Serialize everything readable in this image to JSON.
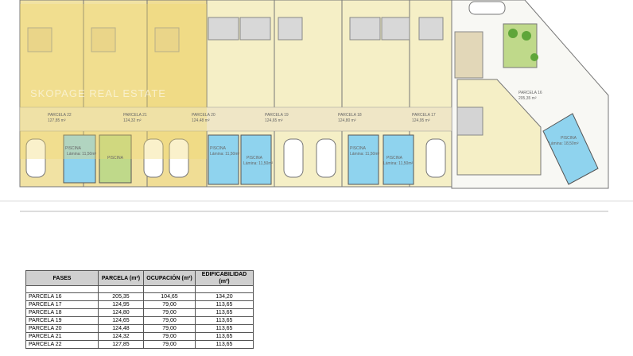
{
  "plan": {
    "watermark": "SKOPAGE REAL ESTATE",
    "parcels": [
      {
        "label": "PARCELA 22",
        "area": "127,85 m²"
      },
      {
        "label": "PARCELA 21",
        "area": "124,32 m²"
      },
      {
        "label": "PARCELA 20",
        "area": "124,48 m²"
      },
      {
        "label": "PARCELA 19",
        "area": "124,65 m²"
      },
      {
        "label": "PARCELA 18",
        "area": "124,80 m²"
      },
      {
        "label": "PARCELA 17",
        "area": "124,95 m²"
      },
      {
        "label": "PARCELA 16",
        "area": "205,35 m²"
      }
    ],
    "pool_label": "PISCINA",
    "pool_small": "Lámina: 11,50m²",
    "pool_big": "Lámina: 18,50m²"
  },
  "table": {
    "headers": [
      "FASES",
      "PARCELA (m²)",
      "OCUPACIÓN (m²)",
      "EDIFICABILIDAD (m²)"
    ],
    "rows": [
      [
        "PARCELA 16",
        "205,35",
        "104,65",
        "134,20"
      ],
      [
        "PARCELA 17",
        "124,95",
        "79,00",
        "113,65"
      ],
      [
        "PARCELA 18",
        "124,80",
        "79,00",
        "113,65"
      ],
      [
        "PARCELA 19",
        "124,65",
        "79,00",
        "113,65"
      ],
      [
        "PARCELA 20",
        "124,48",
        "79,00",
        "113,65"
      ],
      [
        "PARCELA 21",
        "124,32",
        "79,00",
        "113,65"
      ],
      [
        "PARCELA 22",
        "127,85",
        "79,00",
        "113,65"
      ]
    ]
  }
}
